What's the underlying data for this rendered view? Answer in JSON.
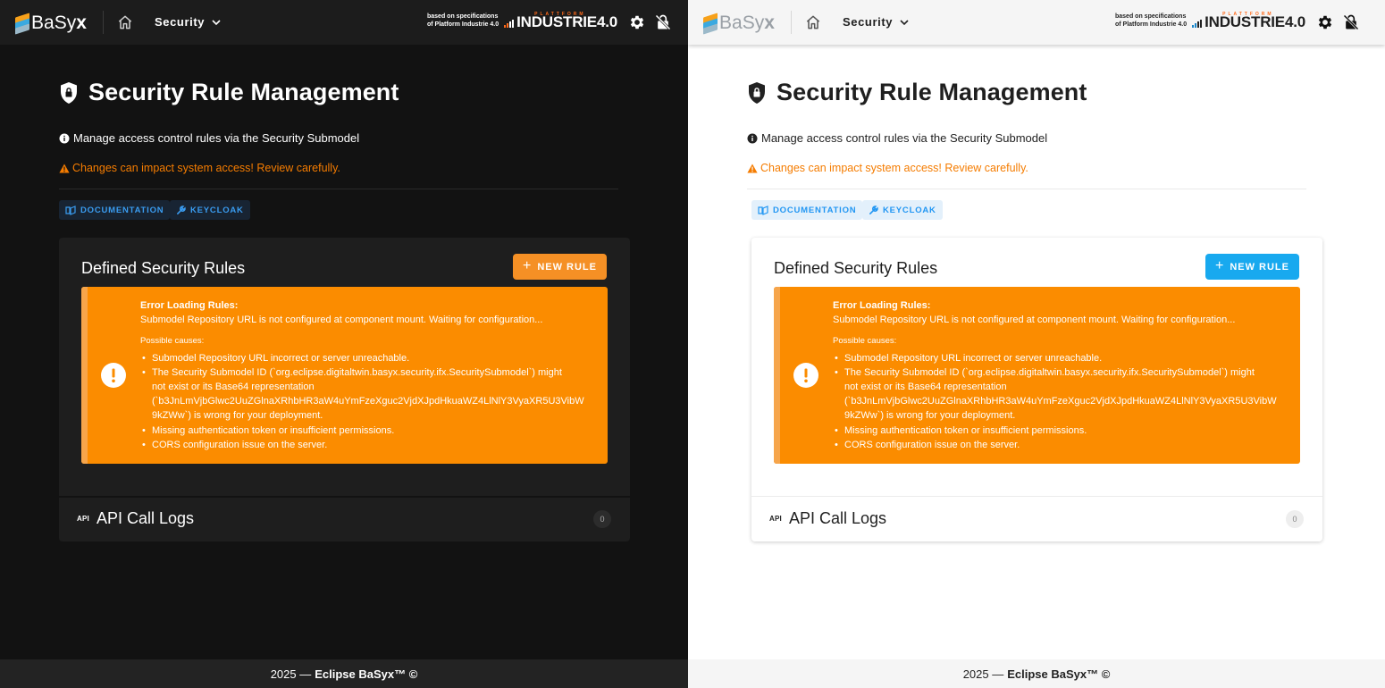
{
  "brand": {
    "logo_prefix": "Ba",
    "logo_suffix": "Sy",
    "logo_x": "x"
  },
  "nav": {
    "section_label": "Security"
  },
  "industrie": {
    "small_line1": "based on specifications",
    "small_line2": "of Platform Industrie 4.0",
    "platform": "PLATTFORM",
    "main": "INDUSTRIE4.0"
  },
  "page": {
    "title": "Security Rule Management",
    "info": "Manage access control rules via the Security Submodel",
    "warning": "Changes can impact system access! Review carefully.",
    "documentation_button": "DOCUMENTATION",
    "keycloak_button": "KEYCLOAK"
  },
  "rules_card": {
    "title": "Defined Security Rules",
    "new_rule_button": "NEW RULE"
  },
  "error_alert": {
    "heading": "Error Loading Rules:",
    "message": "Submodel Repository URL is not configured at component mount. Waiting for configuration...",
    "causes_label": "Possible causes:",
    "cause_1": "Submodel Repository URL incorrect or server unreachable.",
    "cause_2_line1": "The Security Submodel ID (`org.eclipse.digitaltwin.basyx.security.ifx.SecuritySubmodel`) might",
    "cause_2_line2": "not exist or its Base64 representation",
    "cause_2_line3": "(`b3JnLmVjbGlwc2UuZGlnaXRhbHR3aW4uYmFzeXguc2VjdXJpdHkuaWZ4LlNlY3VyaXR5U3VibW",
    "cause_2_line4": "9kZWw`) is wrong for your deployment.",
    "cause_3": "Missing authentication token or insufficient permissions.",
    "cause_4": "CORS configuration issue on the server."
  },
  "api_logs": {
    "tag": "API",
    "title": "API Call Logs",
    "count": "0"
  },
  "footer": {
    "year": "2025 —",
    "name": "Eclipse BaSyx™ ©"
  },
  "colors": {
    "dark_bg": "#121212",
    "light_bg": "#ffffff",
    "warning": "#f57c00",
    "alert_bg": "#fb8c00",
    "dark_accent": "#f59025",
    "light_accent": "#18a9ef"
  },
  "icons": [
    "home-icon",
    "chevron-down-icon",
    "gear-icon",
    "lock-off-icon",
    "shield-lock-icon",
    "info-icon",
    "warning-icon",
    "book-icon",
    "wrench-icon",
    "plus-icon",
    "exclamation-circle-icon",
    "api-icon"
  ]
}
